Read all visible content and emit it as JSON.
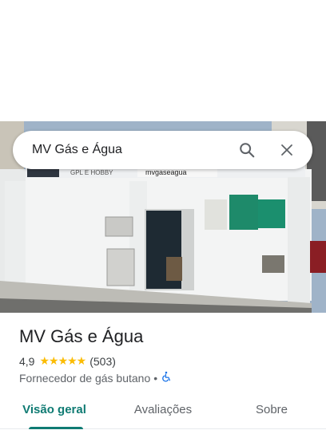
{
  "search": {
    "query": "MV Gás e Água"
  },
  "photo": {
    "sign_left_text": "GPL E HOBBY",
    "sign_right_text": "mvgaseagua"
  },
  "place": {
    "name": "MV Gás e Água",
    "rating": "4,9",
    "stars": "★★★★★",
    "review_count": "(503)",
    "category": "Fornecedor de gás butano",
    "separator": "•",
    "accessibility_icon": "wheelchair-icon"
  },
  "tabs": [
    {
      "label": "Visão geral",
      "active": true
    },
    {
      "label": "Avaliações",
      "active": false
    },
    {
      "label": "Sobre",
      "active": false
    }
  ],
  "colors": {
    "accent": "#0f7b73",
    "stars": "#fbbc04",
    "accessibility": "#1a73e8"
  }
}
